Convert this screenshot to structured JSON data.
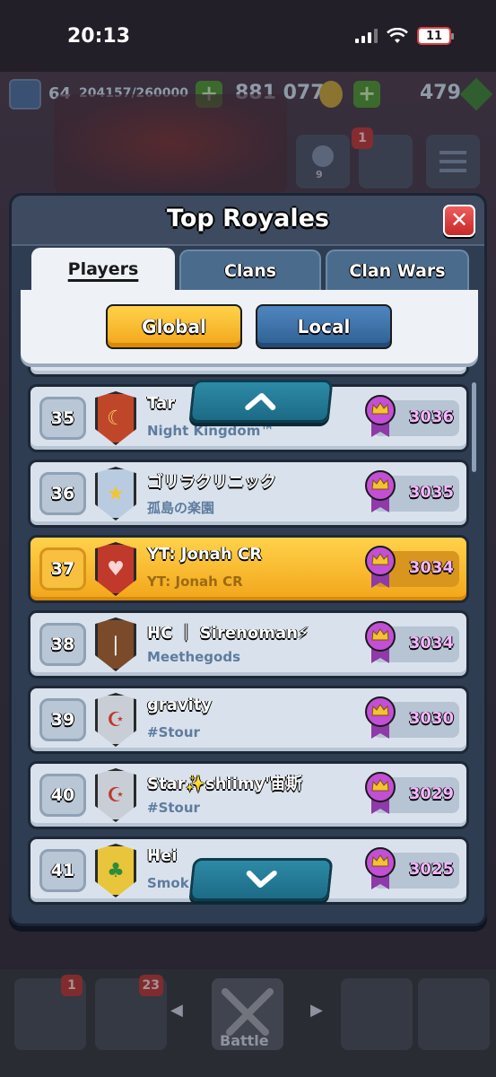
{
  "status_bar": {
    "time": "20:13",
    "battery": "11"
  },
  "resources": {
    "level": "64",
    "xp": "204157/260000",
    "gold": "881 077",
    "gems": "479"
  },
  "notifications": {
    "social_badge": "9",
    "news_badge": "1"
  },
  "dialog": {
    "title": "Top Royales",
    "tabs": [
      {
        "label": "Players",
        "active": true
      },
      {
        "label": "Clans",
        "active": false
      },
      {
        "label": "Clan Wars",
        "active": false
      }
    ],
    "scope": {
      "global_label": "Global",
      "local_label": "Local",
      "selected": "Global"
    }
  },
  "leaderboard": [
    {
      "rank": "35",
      "name": "Tar",
      "clan": "Night Kingdom™",
      "trophies": "3036",
      "badge_color": "#c0462a",
      "badge_icon": "moon-icon"
    },
    {
      "rank": "36",
      "name": "ゴリラクリニック",
      "clan": "孤島の楽園",
      "trophies": "3035",
      "badge_color": "#b9cbe0",
      "badge_icon": "star-icon"
    },
    {
      "rank": "37",
      "name": "YT: Jonah CR",
      "clan": "YT: Jonah CR",
      "trophies": "3034",
      "badge_color": "#c0392b",
      "badge_icon": "heart-icon",
      "highlighted": true
    },
    {
      "rank": "38",
      "name": "HC ｜ Sirenoman⚡",
      "clan": "Meethegods",
      "trophies": "3034",
      "badge_color": "#7a4a2a",
      "badge_icon": "bamboo-icon"
    },
    {
      "rank": "39",
      "name": "gravity",
      "clan": "#Stour",
      "trophies": "3030",
      "badge_color": "#c9ced6",
      "badge_icon": "crescent-icon"
    },
    {
      "rank": "40",
      "name": "Star✨shiimy'宙斯",
      "clan": "#Stour",
      "trophies": "3029",
      "badge_color": "#c9ced6",
      "badge_icon": "crescent-icon"
    },
    {
      "rank": "41",
      "name": "Hei",
      "clan": "Smok",
      "trophies": "3025",
      "badge_color": "#e8c53a",
      "badge_icon": "tree-icon"
    }
  ],
  "bottom_nav": {
    "shop_badge": "1",
    "cards_badge": "23",
    "battle_label": "Battle"
  },
  "colors": {
    "highlight": "#ffc531",
    "panel": "#2f3d52",
    "trophy_text": "#f4b6ff"
  }
}
